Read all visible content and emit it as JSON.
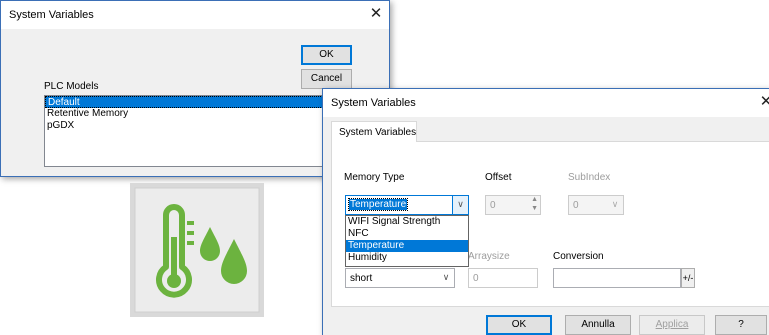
{
  "dialog1": {
    "title": "System Variables",
    "close_glyph": "✕",
    "ok_label": "OK",
    "cancel_label": "Cancel",
    "list_label": "PLC Models",
    "list_items": [
      "Default",
      "Retentive Memory",
      "pGDX"
    ],
    "selected_item": "Default"
  },
  "app_icon": {
    "name": "thermometer-humidity-icon",
    "colors": {
      "tile": "#d9d9d9",
      "tile_inner": "#ececec",
      "green": "#6cb33f"
    }
  },
  "dialog2": {
    "title": "System Variables",
    "close_glyph": "✕",
    "tab_label": "System Variables",
    "memory_type_label": "Memory Type",
    "memory_type_value": "Temperature",
    "memory_type_options": [
      "WIFI Signal Strength",
      "NFC",
      "Temperature",
      "Humidity"
    ],
    "memory_type_selected": "Temperature",
    "offset_label": "Offset",
    "offset_value": "0",
    "subindex_label": "SubIndex",
    "subindex_value": "0",
    "arraysize_label": "Arraysize",
    "arraysize_value": "0",
    "type_value": "short",
    "conversion_label": "Conversion",
    "conversion_value": "",
    "sign_toggle_label": "+/-",
    "ok_label": "OK",
    "cancel_label": "Annulla",
    "apply_label": "Applica",
    "help_label": "?"
  }
}
